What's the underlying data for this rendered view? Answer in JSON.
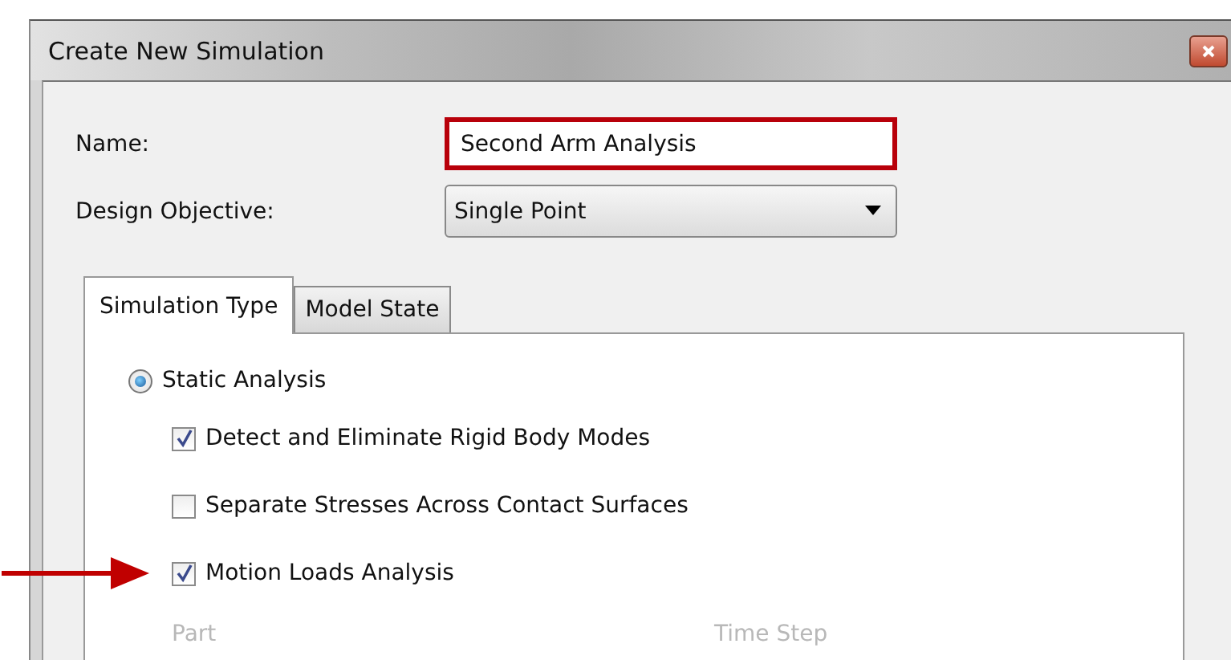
{
  "window": {
    "title": "Create New Simulation"
  },
  "fields": [
    {
      "kind": "text",
      "label": "Name:",
      "value": "Second Arm Analysis",
      "highlighted": true
    },
    {
      "kind": "dropdown",
      "label": "Design Objective:",
      "value": "Single Point",
      "highlighted": false
    }
  ],
  "tabs": [
    {
      "label": "Simulation Type",
      "selected": true
    },
    {
      "label": "Model State",
      "selected": false
    }
  ],
  "options": [
    {
      "kind": "radio",
      "label": "Static Analysis",
      "checked": true,
      "pointed": false
    },
    {
      "kind": "checkbox",
      "label": "Detect and Eliminate Rigid Body Modes",
      "checked": true,
      "pointed": false
    },
    {
      "kind": "checkbox",
      "label": "Separate Stresses Across Contact Surfaces",
      "checked": false,
      "pointed": false
    },
    {
      "kind": "checkbox",
      "label": "Motion Loads Analysis",
      "checked": true,
      "pointed": true
    }
  ],
  "table": {
    "columns": [
      "Part",
      "Time Step"
    ]
  }
}
